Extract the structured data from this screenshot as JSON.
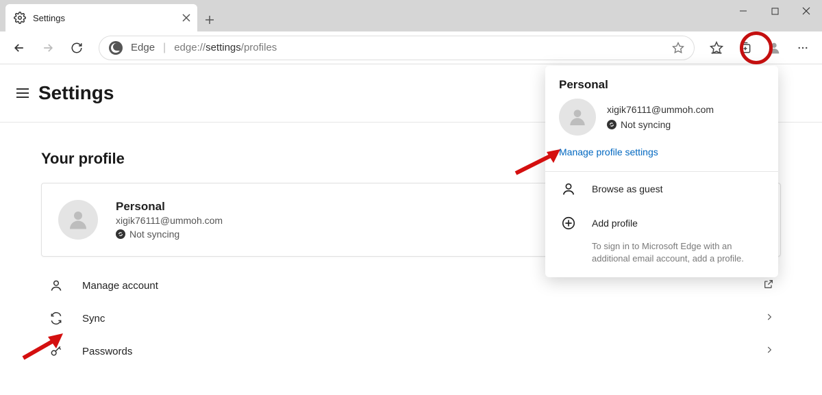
{
  "tab": {
    "title": "Settings"
  },
  "address": {
    "prefix": "Edge",
    "url_gray": "edge://",
    "url_dark": "settings",
    "url_tail": "/profiles"
  },
  "page": {
    "title": "Settings",
    "section": "Your profile"
  },
  "profile": {
    "name": "Personal",
    "email": "xigik76111@ummoh.com",
    "sync_status": "Not syncing"
  },
  "items": {
    "manage": "Manage account",
    "sync": "Sync",
    "passwords": "Passwords"
  },
  "popup": {
    "title": "Personal",
    "email": "xigik76111@ummoh.com",
    "sync_status": "Not syncing",
    "manage_link": "Manage profile settings",
    "browse_guest": "Browse as guest",
    "add_profile": "Add profile",
    "add_note": "To sign in to Microsoft Edge with an additional email account, add a profile."
  }
}
